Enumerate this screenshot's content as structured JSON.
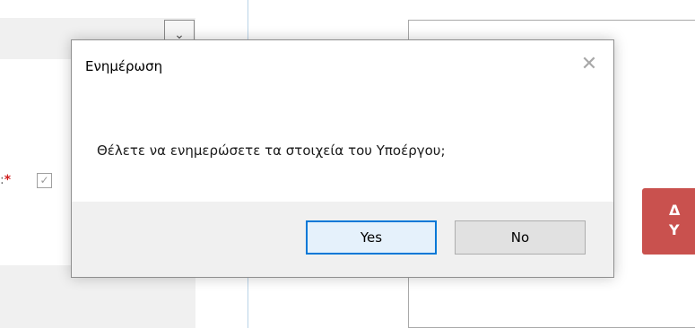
{
  "background": {
    "dropdown_arrow": "⌄",
    "label_fragment": ":",
    "required_mark": "*",
    "checkbox_mark": "✓",
    "red_button_text_line1": "Δ",
    "red_button_text_line2": "Y"
  },
  "dialog": {
    "title": "Ενημέρωση",
    "close_glyph": "✕",
    "message": "Θέλετε να ενημερώσετε τα στοιχεία του Υποέργου;",
    "yes_label": "Yes",
    "no_label": "No"
  },
  "colors": {
    "primary_button_border": "#0078d7",
    "footer_background": "#f0f0f0",
    "required_asterisk": "#d11f1f",
    "red_button": "#c9514e"
  }
}
